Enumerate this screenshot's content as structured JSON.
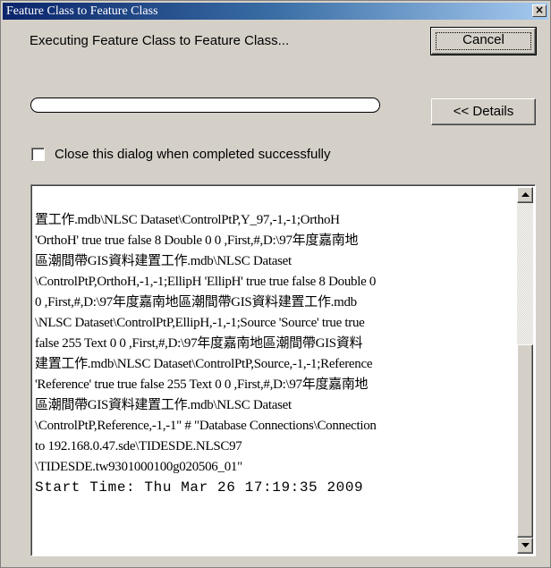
{
  "window": {
    "title": "Feature Class to Feature Class",
    "close_glyph": "×"
  },
  "status": {
    "text": "Executing Feature Class to Feature Class...",
    "progress": 0
  },
  "buttons": {
    "cancel": "Cancel",
    "details": "<< Details"
  },
  "checkbox": {
    "label": "Close this dialog when completed successfully",
    "checked": false
  },
  "log": {
    "lines": [
      "置工作.mdb\\NLSC Dataset\\ControlPtP,Y_97,-1,-1;OrthoH",
      "'OrthoH' true true false 8 Double 0 0 ,First,#,D:\\97年度嘉南地",
      "區潮間帶GIS資料建置工作.mdb\\NLSC Dataset",
      "\\ControlPtP,OrthoH,-1,-1;EllipH 'EllipH' true true false 8 Double 0",
      "0 ,First,#,D:\\97年度嘉南地區潮間帶GIS資料建置工作.mdb",
      "\\NLSC Dataset\\ControlPtP,EllipH,-1,-1;Source 'Source' true true",
      "false 255 Text 0 0 ,First,#,D:\\97年度嘉南地區潮間帶GIS資料",
      "建置工作.mdb\\NLSC Dataset\\ControlPtP,Source,-1,-1;Reference",
      "'Reference' true true false 255 Text 0 0 ,First,#,D:\\97年度嘉南地",
      "區潮間帶GIS資料建置工作.mdb\\NLSC Dataset",
      "\\ControlPtP,Reference,-1,-1\" # \"Database Connections\\Connection",
      "to 192.168.0.47.sde\\TIDESDE.NLSC97",
      "\\TIDESDE.tw9301000100g020506_01\""
    ],
    "start_time": "Start Time: Thu Mar 26 17:19:35 2009"
  },
  "icons": {
    "close": "close-icon",
    "scroll_up": "arrow-up-icon",
    "scroll_down": "arrow-down-icon"
  }
}
